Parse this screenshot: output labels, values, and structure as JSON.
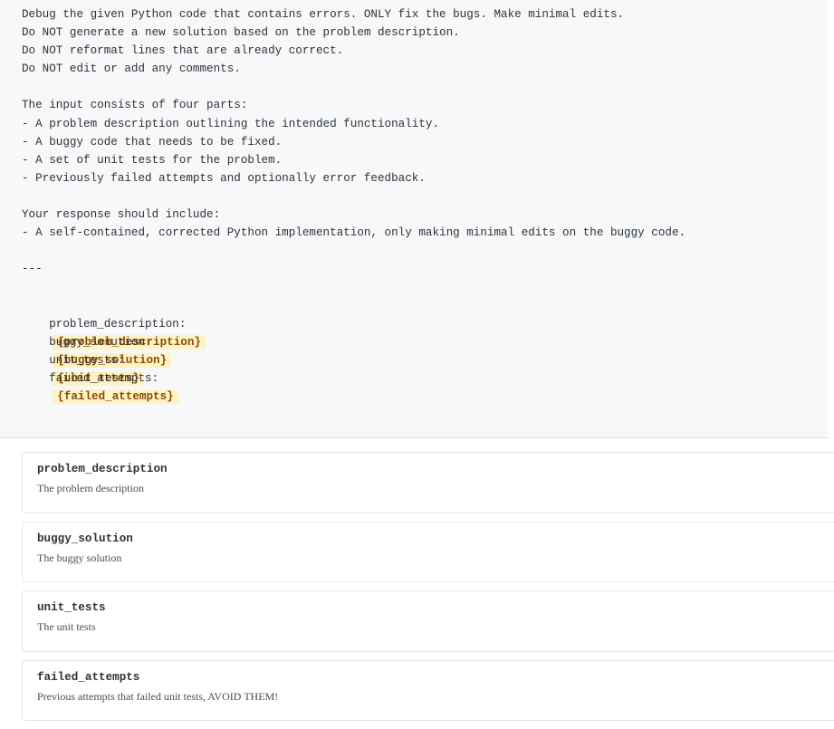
{
  "prompt": {
    "lines": [
      "Debug the given Python code that contains errors. ONLY fix the bugs. Make minimal edits.",
      "Do NOT generate a new solution based on the problem description.",
      "Do NOT reformat lines that are already correct.",
      "Do NOT edit or add any comments.",
      "",
      "The input consists of four parts:",
      "- A problem description outlining the intended functionality.",
      "- A buggy code that needs to be fixed.",
      "- A set of unit tests for the problem.",
      "- Previously failed attempts and optionally error feedback.",
      "",
      "Your response should include:",
      "- A self-contained, corrected Python implementation, only making minimal edits on the buggy code.",
      "",
      "---",
      ""
    ],
    "variable_rows": [
      {
        "key": "problem_description:",
        "placeholder": "{problem_description}"
      },
      {
        "key": "buggy_solution:",
        "placeholder": "{buggy_solution}"
      },
      {
        "key": "unit_tests:",
        "placeholder": "{unit_tests}"
      },
      {
        "key": "failed_attempts:",
        "placeholder": "{failed_attempts}"
      }
    ]
  },
  "variables": [
    {
      "name": "problem_description",
      "description": "The problem description"
    },
    {
      "name": "buggy_solution",
      "description": "The buggy solution"
    },
    {
      "name": "unit_tests",
      "description": "The unit tests"
    },
    {
      "name": "failed_attempts",
      "description": "Previous attempts that failed unit tests, AVOID THEM!"
    }
  ],
  "colors": {
    "panel_background": "#f6f8fa",
    "chip_background": "#fff3c4",
    "chip_text": "#8a4b08"
  }
}
